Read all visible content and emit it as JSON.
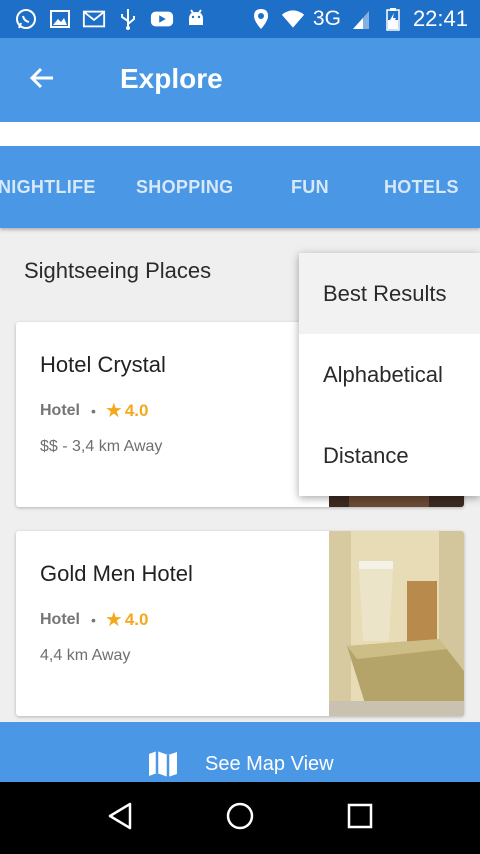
{
  "status_bar": {
    "time": "22:41",
    "network": "3G",
    "left_icons": [
      "whatsapp-icon",
      "gallery-icon",
      "gmail-icon",
      "usb-icon",
      "youtube-icon",
      "android-icon"
    ],
    "right_icons": [
      "location-icon",
      "wifi-icon",
      "signal-icon",
      "battery-icon"
    ]
  },
  "app_bar": {
    "title": "Explore",
    "back_icon": "arrow-back-icon"
  },
  "tabs": [
    {
      "label": "NIGHTLIFE"
    },
    {
      "label": "SHOPPING"
    },
    {
      "label": "FUN"
    },
    {
      "label": "HOTELS"
    }
  ],
  "section": {
    "title": "Sightseeing Places"
  },
  "cards": [
    {
      "title": "Hotel Crystal",
      "type": "Hotel",
      "rating": "4.0",
      "subtitle": "$$ - 3,4 km Away"
    },
    {
      "title": "Gold Men Hotel",
      "type": "Hotel",
      "rating": "4.0",
      "subtitle": "4,4 km Away"
    }
  ],
  "sort_menu": {
    "items": [
      {
        "label": "Best Results",
        "selected": true
      },
      {
        "label": "Alphabetical",
        "selected": false
      },
      {
        "label": "Distance",
        "selected": false
      }
    ]
  },
  "map_bar": {
    "label": "See Map View",
    "icon": "map-icon"
  },
  "nav_bar": {
    "icons": [
      "nav-back-icon",
      "nav-home-icon",
      "nav-recents-icon"
    ]
  },
  "colors": {
    "status_bar": "#1e6fc7",
    "primary": "#4a97e5",
    "rating": "#f4a81d",
    "background": "#efefef"
  }
}
